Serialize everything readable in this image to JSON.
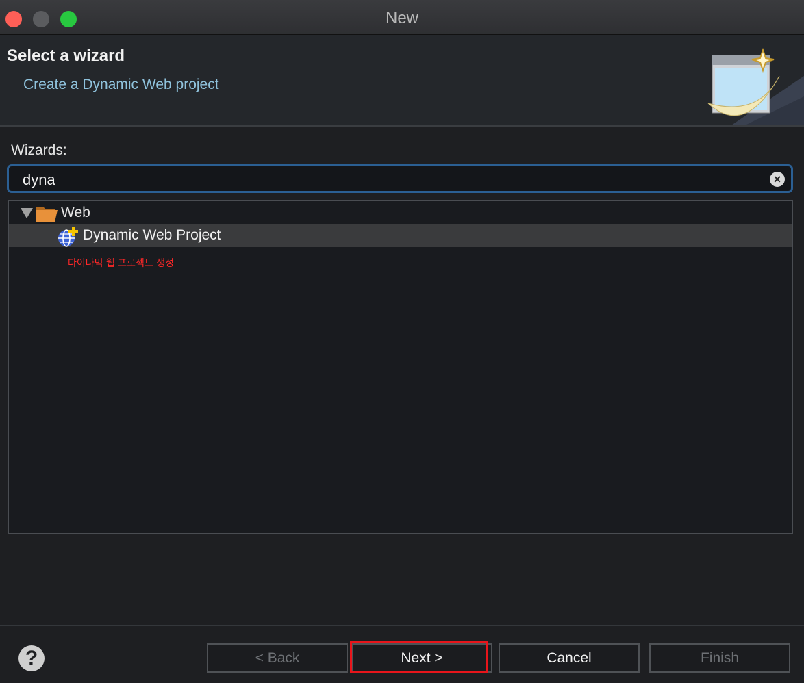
{
  "window": {
    "title": "New"
  },
  "header": {
    "title": "Select a wizard",
    "subtitle": "Create a Dynamic Web project"
  },
  "wizards": {
    "label": "Wizards:",
    "filter_value": "dyna",
    "clear_icon": "clear-icon"
  },
  "tree": {
    "items": [
      {
        "label": "Web",
        "icon": "folder-open-icon",
        "expanded": true
      },
      {
        "label": "Dynamic Web Project",
        "icon": "globe-plus-icon",
        "selected": true
      }
    ]
  },
  "annotation": {
    "text": "다이나믹 웹 프로젝트 생성"
  },
  "footer": {
    "help_symbol": "?",
    "back_label": "< Back",
    "next_label": "Next >",
    "cancel_label": "Cancel",
    "finish_label": "Finish"
  },
  "colors": {
    "accent_border": "#2b5f93",
    "subtitle": "#8fc2dc",
    "highlight": "#e8151b",
    "selection": "#3a3b3d"
  }
}
